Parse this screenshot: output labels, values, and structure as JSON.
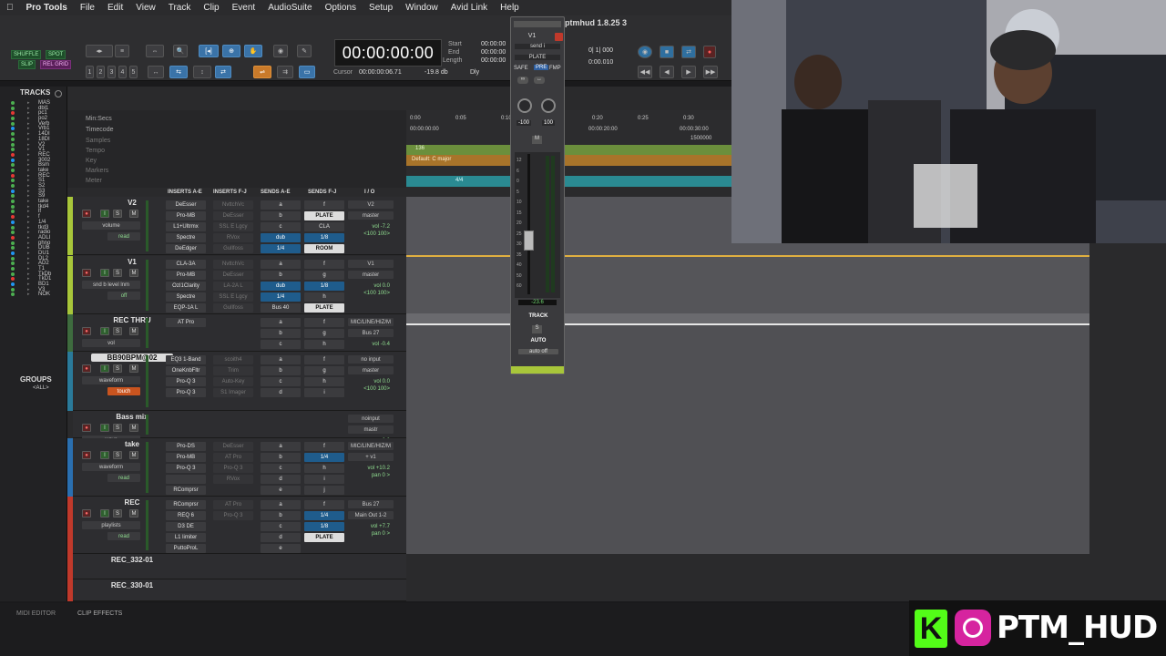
{
  "menubar": {
    "apple": "",
    "items": [
      "Pro Tools",
      "File",
      "Edit",
      "View",
      "Track",
      "Clip",
      "Event",
      "AudioSuite",
      "Options",
      "Setup",
      "Window",
      "Avid Link",
      "Help"
    ],
    "window_title": "ptmhud 1.8.25 3"
  },
  "toolbar": {
    "modes": [
      "SHUFFLE",
      "SPOT",
      "SLIP",
      "REL GRID"
    ],
    "counter_main": "00:00:00:00",
    "start_label": "Start",
    "end_label": "End",
    "length_label": "Length",
    "start_value": "00:00:00",
    "end_value": "00:00:00",
    "length_value": "00:00:00",
    "cursor_label": "Cursor",
    "cursor_value": "00:00:00:06.71",
    "cursor_db": "-19.8 db",
    "dly": "Dly",
    "nudge": "0| 1| 000",
    "grid_value": "0:00.010",
    "numbers": [
      "1",
      "2",
      "3",
      "4",
      "5"
    ]
  },
  "tracks_panel": {
    "title": "TRACKS",
    "items": [
      "MAS",
      "dbl1",
      "pc1",
      "po2",
      "Verb",
      "Vrb1",
      "14DI",
      "18DI",
      "V2",
      "V1",
      "REC",
      "3002",
      "Bsm",
      "take",
      "REC",
      "S1",
      "S2",
      "S3",
      "S9",
      "take",
      "tkd4",
      "lf",
      "f",
      "1/4",
      "tkd3",
      "radio",
      "ADLI",
      "phno",
      "DUB",
      "DU1",
      "DL2",
      "AD2",
      "T1",
      "TkDb",
      "TkD1",
      "BD1",
      "V3",
      "NOK"
    ],
    "groups_title": "GROUPS",
    "groups_item": "<ALL>"
  },
  "rulers": {
    "labels": [
      "Min:Secs",
      "Timecode",
      "Samples",
      "Tempo",
      "Key",
      "Markers",
      "Meter"
    ],
    "minsecs_ticks": [
      "0:00",
      "0:05",
      "0:10",
      "0:20",
      "0:25",
      "0:30"
    ],
    "timecode_ticks": [
      "00:00:00:00",
      "00:00:20:00",
      "00:00:30:00"
    ],
    "samples_ticks": [
      "1500000"
    ],
    "tempo": "136",
    "key": "Default: C major",
    "meter": "4/4"
  },
  "mix_headers": [
    "INSERTS A-E",
    "INSERTS F-J",
    "SENDS A-E",
    "SENDS F-J",
    "I / O"
  ],
  "tracks": [
    {
      "name": "V2",
      "view": "volume",
      "auto": "read",
      "ins_ae": [
        "DeEsser",
        "Pro-MB",
        "L1+Ultrmx",
        "Spectre",
        "DeEdger"
      ],
      "ins_fj": [
        "NvttchVc",
        "DeEsser",
        "SSL E Lgcy",
        "RVox",
        "Gullfoss"
      ],
      "sends": [
        "a",
        "b",
        "c",
        "dub",
        "1/4"
      ],
      "sends_fj": [
        "f",
        "PLATE",
        "CLA",
        "1/8",
        "ROOM",
        "PLATE"
      ],
      "io": [
        "V2",
        "master"
      ],
      "vol": "vol   -7.2",
      "pan": "<100  100>"
    },
    {
      "name": "V1",
      "view": "snd b level lnm",
      "auto": "off",
      "ins_ae": [
        "CLA-3A",
        "Pro-MB",
        "OzI1Clarity",
        "Spectre",
        "EQP-1A L"
      ],
      "ins_fj": [
        "NvttchVc",
        "DeEsser",
        "LA-2A L",
        "SSL E Lgcy",
        "Gullfoss"
      ],
      "sends": [
        "a",
        "b",
        "dub",
        "1/4",
        "Bus 40"
      ],
      "sends_fj": [
        "f",
        "g",
        "1/8",
        "h",
        "PLATE"
      ],
      "io": [
        "V1",
        "master"
      ],
      "vol": "vol    0.0",
      "pan": "<100  100>"
    },
    {
      "name": "REC THRU",
      "view": "vol",
      "auto": "",
      "ins_ae": [
        "AT Pro"
      ],
      "ins_fj": [],
      "sends": [
        "a",
        "b",
        "c"
      ],
      "sends_fj": [
        "f",
        "g",
        "h"
      ],
      "io": [
        "MIC/LINE/HIZ/M",
        "Bus 27"
      ],
      "vol": "vol   -0.4",
      "pan": ""
    },
    {
      "name": "BB90BPM@02",
      "view": "waveform",
      "auto": "touch",
      "ins_ae": [
        "EQ3 1-Band",
        "OneKnbFltr",
        "Pro-Q 3",
        "Pro-Q 3"
      ],
      "ins_fj": [
        "scoith4",
        "Trim",
        "Auto-Key",
        "S1 Imager"
      ],
      "sends": [
        "a",
        "b",
        "c",
        "d"
      ],
      "sends_fj": [
        "f",
        "g",
        "h",
        "i"
      ],
      "io": [
        "no input",
        "master"
      ],
      "vol": "vol    0.0",
      "pan": "<100  100>"
    },
    {
      "name": "Bass mix",
      "view": "wave",
      "auto": "touch",
      "ins_ae": [],
      "ins_fj": [],
      "sends": [],
      "sends_fj": [],
      "io": [
        "noinput",
        "mastr"
      ],
      "vol": "0.0",
      "pan": "P  P"
    },
    {
      "name": "take",
      "view": "waveform",
      "auto": "read",
      "ins_ae": [
        "Pro-DS",
        "Pro-MB",
        "Pro-Q 3",
        "",
        "RComprsr"
      ],
      "ins_fj": [
        "DeEsser",
        "AT Pro",
        "Pro-Q 3",
        "RVox"
      ],
      "sends": [
        "a",
        "b",
        "c",
        "d",
        "e"
      ],
      "sends_fj": [
        "f",
        "1/4",
        "h",
        "i",
        "j"
      ],
      "io": [
        "MIC/LINE/HIZ/M",
        "+ v1"
      ],
      "vol": "vol  +10.2",
      "pan": "pan     0 >"
    },
    {
      "name": "REC",
      "view": "playlists",
      "auto": "read",
      "ins_ae": [
        "RComprsr",
        "REQ 6",
        "D3 DE",
        "L1 limiter",
        "PuttoProL"
      ],
      "ins_fj": [
        "AT Pro",
        "Pro-Q 3"
      ],
      "sends": [
        "a",
        "b",
        "c",
        "d",
        "e"
      ],
      "sends_fj": [
        "f",
        "1/4",
        "1/8",
        "PLATE"
      ],
      "io": [
        "Bus 27",
        "Main Out 1-2"
      ],
      "vol": "vol   +7.7",
      "pan": "pan     0 >"
    },
    {
      "name": "REC_332-01",
      "view": "",
      "auto": "",
      "ins_ae": [],
      "ins_fj": [],
      "sends": [],
      "sends_fj": [],
      "io": [],
      "vol": "",
      "pan": ""
    },
    {
      "name": "REC_330-01",
      "view": "",
      "auto": "",
      "ins_ae": [],
      "ins_fj": [],
      "sends": [],
      "sends_fj": [],
      "io": [],
      "vol": "",
      "pan": ""
    }
  ],
  "mixer_strip": {
    "name": "V1",
    "send": "send i",
    "plate": "PLATE",
    "safe": "SAFE",
    "pre": "PRE",
    "fmp": "FMP",
    "pan_left": "-100",
    "pan_right": "100",
    "m": "M",
    "fader_value": "-23.6",
    "track_label": "TRACK",
    "s": "S",
    "auto_label": "AUTO",
    "auto_mode": "auto off",
    "scale": [
      "12",
      "6",
      "0",
      "5",
      "10",
      "15",
      "20",
      "25",
      "30",
      "35",
      "40",
      "50",
      "60"
    ]
  },
  "bottom": {
    "tabs": [
      "MIDI EDITOR",
      "CLIP EFFECTS"
    ]
  },
  "brand": {
    "handle": "PTM_HUD",
    "k_letter": "K"
  },
  "colors": {
    "accent_blue": "#3a73a8",
    "rec_red": "#c0392b",
    "clip_green": "#7fa84a",
    "clip_orange": "#b57a2a",
    "meter_teal": "#2a8a92",
    "brand_green": "#53fc18"
  }
}
